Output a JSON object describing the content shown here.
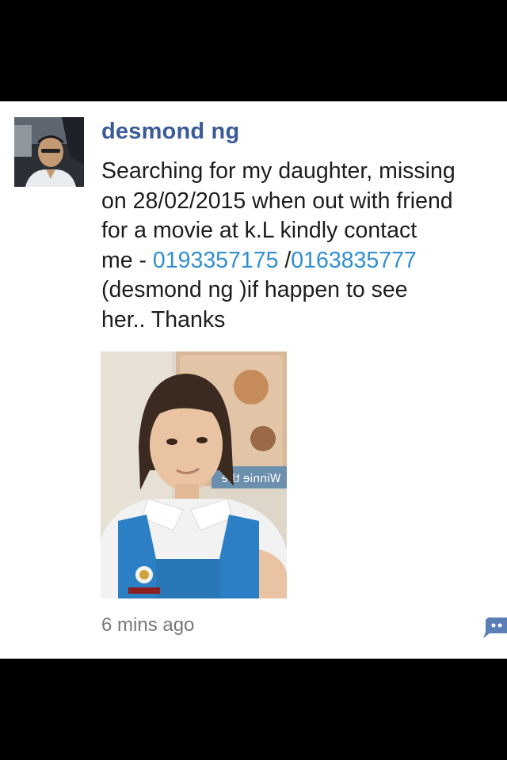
{
  "post": {
    "author": "desmond ng",
    "message": {
      "line1": "Searching for my daughter, missing",
      "line2": "on 28/02/2015 when out with friend",
      "line3": "for a movie at k.L kindly contact",
      "line4_prefix": "me - ",
      "phone1": "0193357175",
      "line4_sep": " /",
      "phone2": "0163835777",
      "line5": "(desmond ng )if happen to see",
      "line6": "her.. Thanks"
    },
    "photo": {
      "mirrored_sign_text": "Winnie the"
    },
    "timestamp": "6 mins ago"
  },
  "icons": {
    "avatar": "profile-photo",
    "comment": "chat-bubble-icon"
  },
  "colors": {
    "author": "#3b5a98",
    "link": "#2f8fd0",
    "timestamp": "#777777",
    "text": "#1d1d1d"
  }
}
